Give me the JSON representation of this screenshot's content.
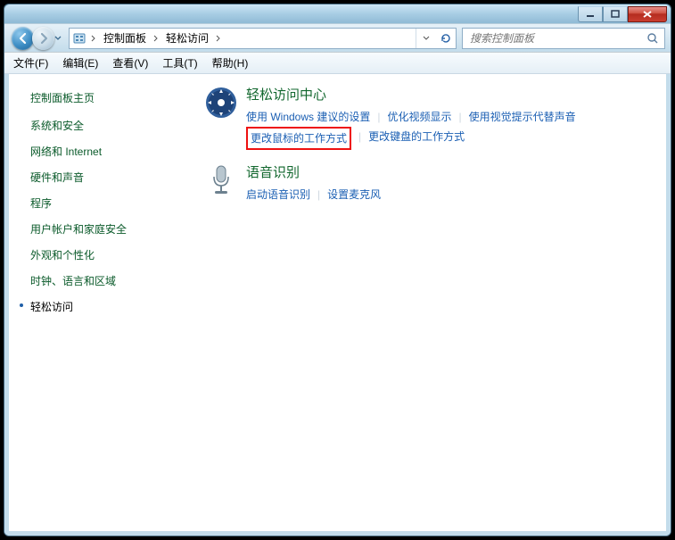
{
  "titlebar": {
    "min_tip": "Minimize",
    "max_tip": "Maximize",
    "close_tip": "Close"
  },
  "nav": {
    "back_tip": "Back",
    "forward_tip": "Forward"
  },
  "breadcrumb": {
    "item0": "控制面板",
    "item1": "轻松访问"
  },
  "search": {
    "placeholder": "搜索控制面板"
  },
  "menu": {
    "file": "文件(F)",
    "edit": "编辑(E)",
    "view": "查看(V)",
    "tools": "工具(T)",
    "help": "帮助(H)"
  },
  "sidebar": {
    "heading": "控制面板主页",
    "links": [
      "系统和安全",
      "网络和 Internet",
      "硬件和声音",
      "程序",
      "用户帐户和家庭安全",
      "外观和个性化",
      "时钟、语言和区域"
    ],
    "current": "轻松访问"
  },
  "sections": {
    "ease": {
      "title": "轻松访问中心",
      "links": [
        "使用 Windows 建议的设置",
        "优化视频显示",
        "使用视觉提示代替声音",
        "更改鼠标的工作方式",
        "更改键盘的工作方式"
      ]
    },
    "speech": {
      "title": "语音识别",
      "links": [
        "启动语音识别",
        "设置麦克风"
      ]
    }
  }
}
